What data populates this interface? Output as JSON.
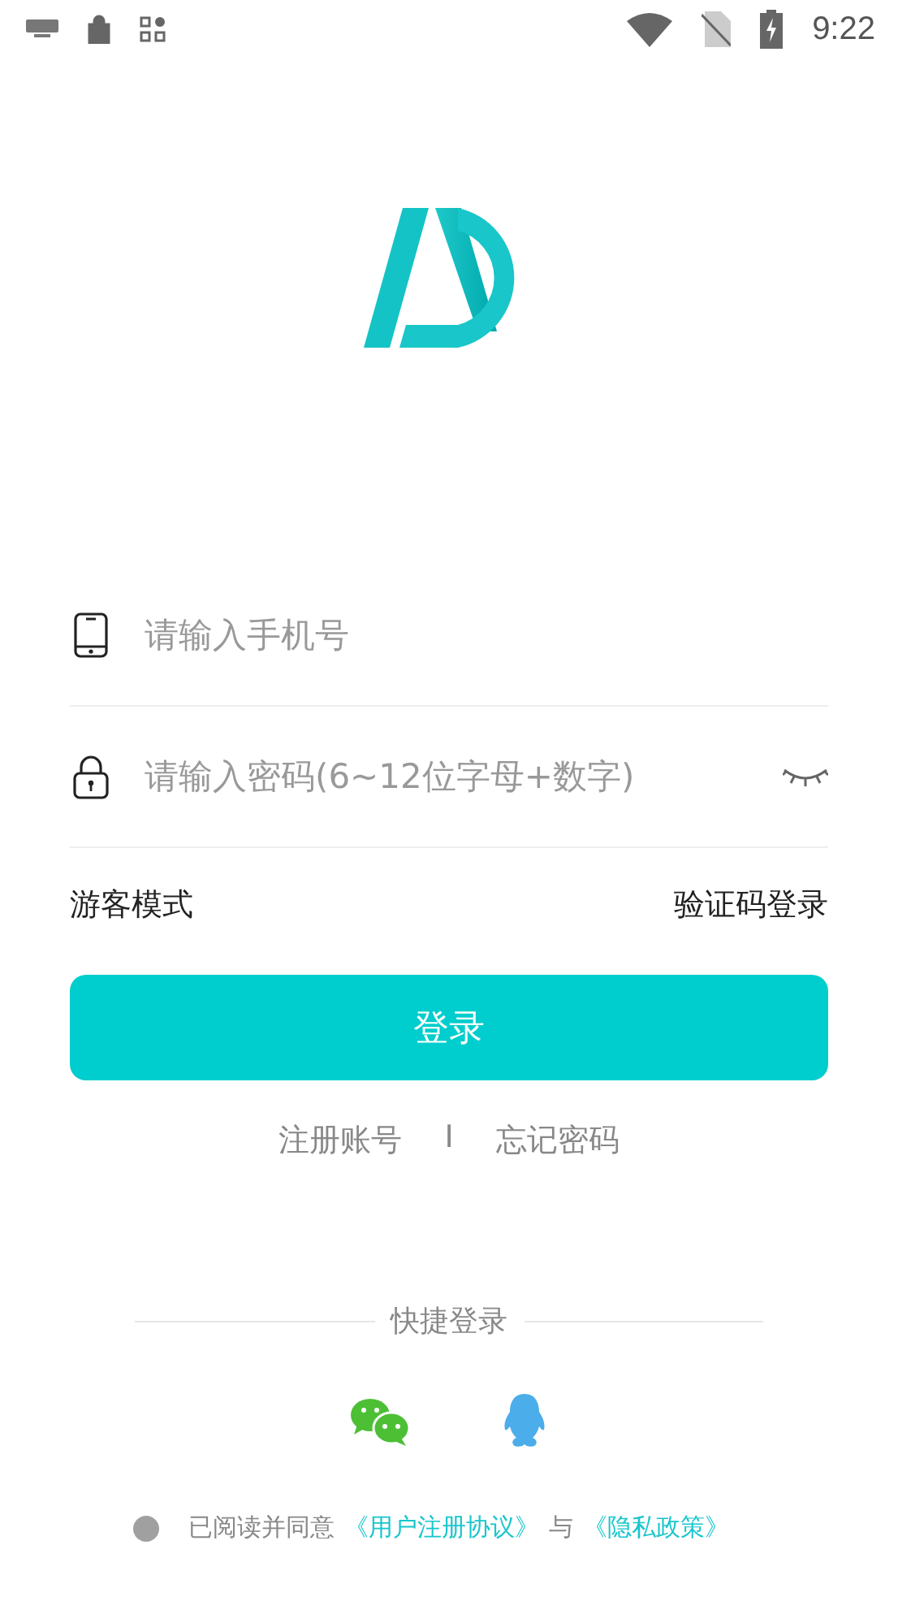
{
  "status_bar": {
    "time": "9:22"
  },
  "login_form": {
    "phone_field": {
      "placeholder": "请输入手机号"
    },
    "password_field": {
      "placeholder": "请输入密码(6~12位字母+数字)",
      "password_visible": false
    }
  },
  "options": {
    "guest_mode": "游客模式",
    "sms_login": "验证码登录"
  },
  "login_button": "登录",
  "links": {
    "register": "注册账号",
    "separator": "I",
    "forgot_password": "忘记密码"
  },
  "quick_login": {
    "title": "快捷登录",
    "providers": [
      {
        "kind": "wechat"
      },
      {
        "kind": "qq"
      }
    ]
  },
  "agreement": {
    "agreed": false,
    "text": "已阅读并同意",
    "user_agreement": "《用户注册协议》",
    "conjunction": "与",
    "privacy_policy": "《隐私政策》"
  }
}
